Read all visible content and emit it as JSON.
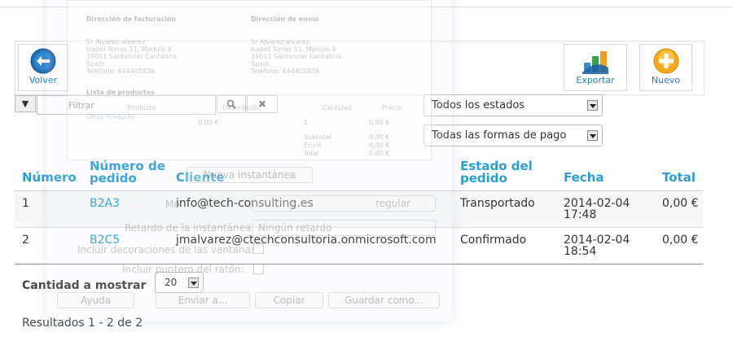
{
  "toolbar": {
    "back_label": "Volver",
    "export_label": "Exportar",
    "new_label": "Nuevo"
  },
  "filter": {
    "placeholder": "Filtrar",
    "search_glyph": "🔍",
    "clear_glyph": "✖",
    "funnel_glyph": "▼"
  },
  "selects": {
    "status": "Todos los estados",
    "payment": "Todas las formas de pago",
    "quantity": "20"
  },
  "table": {
    "headers": {
      "number": "Número",
      "order": "Número de pedido",
      "client": "Cliente",
      "status": "Estado del pedido",
      "date": "Fecha",
      "total": "Total"
    },
    "rows": [
      {
        "number": "1",
        "order": "B2A3",
        "client": "info@tech-consulting.es",
        "status": "Transportado",
        "date": "2014-02-04 17:48",
        "total": "0,00 €"
      },
      {
        "number": "2",
        "order": "B2C5",
        "client": "jmalvarez@ctechconsultoria.onmicrosoft.com",
        "status": "Confirmado",
        "date": "2014-02-04 18:54",
        "total": "0,00 €"
      }
    ]
  },
  "footer": {
    "quantity_label": "Cantidad a mostrar",
    "results": "Resultados 1 - 2 de 2"
  },
  "overlay": {
    "billing_title": "Dirección de facturación",
    "shipping_title": "Dirección de envío",
    "billing_address": "Sr Álvarez alvarez\nIsabel Torres 11, Modulo 4\n39011 Santander Cantabria\nSpain\nTeléfono: 644405836",
    "shipping_address": "Sr Álvarez alvarez\nIsabel Torres 11, Modulo 4\n39011 Santander Cantabria\nSpain\nTeléfono: 644405836",
    "products_title": "Lista de productos",
    "col_product": "Producto",
    "col_desc": "Descripción",
    "col_qty": "Cantidad",
    "col_price": "Precio",
    "product_name": "Otros Producto",
    "product_price": "0,00 €",
    "product_qty": "1",
    "product_total": "0,00 €",
    "subtotal_label": "Subtotal",
    "subtotal_value": "0,00 €",
    "envio_label": "Envío",
    "envio_value": "0,00 €",
    "total_label": "Total",
    "total_value": "0,00 €",
    "new_snapshot": "Nueva instantánea",
    "mode_label": "Mo",
    "mode_value": "regular",
    "delay_label": "Retardo de la instantánea:",
    "delay_value": "Ningún retardo",
    "decor_label": "Incluir decoraciones de las ventanas:",
    "pointer_label": "Incluir puntero del ratón:",
    "help_button": "Ayuda",
    "send_button": "Enviar a...",
    "copy_button": "Copiar",
    "save_button": "Guardar como..."
  }
}
